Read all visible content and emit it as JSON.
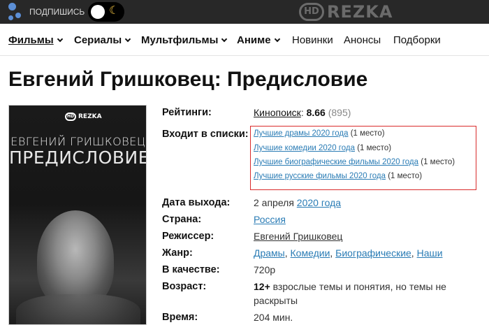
{
  "topbar": {
    "subscribe_label": "ПОДПИШИСЬ",
    "logo_hd": "HD",
    "logo_text": "REZKA"
  },
  "nav": {
    "items": [
      {
        "label": "Фильмы",
        "dropdown": true,
        "active": true
      },
      {
        "label": "Сериалы",
        "dropdown": true
      },
      {
        "label": "Мультфильмы",
        "dropdown": true
      },
      {
        "label": "Аниме",
        "dropdown": true
      },
      {
        "label": "Новинки",
        "dropdown": false
      },
      {
        "label": "Анонсы",
        "dropdown": false
      },
      {
        "label": "Подборки",
        "dropdown": false
      }
    ]
  },
  "page": {
    "title": "Евгений Гришковец: Предисловие"
  },
  "poster": {
    "logo_hd": "HD",
    "logo_text": "REZKA",
    "line1": "ЕВГЕНИЙ ГРИШКОВЕЦ",
    "line2": "ПРЕДИСЛОВИЕ"
  },
  "info": {
    "ratings_label": "Рейтинги:",
    "rating_source": "Кинопоиск",
    "rating_colon": ":",
    "rating_value": "8.66",
    "rating_votes": "(895)",
    "lists_label": "Входит в списки:",
    "lists": [
      {
        "name": "Лучшие драмы 2020 года",
        "place": "(1 место)"
      },
      {
        "name": "Лучшие комедии 2020 года",
        "place": "(1 место)"
      },
      {
        "name": "Лучшие биографические фильмы 2020 года",
        "place": "(1 место)"
      },
      {
        "name": "Лучшие русские фильмы 2020 года",
        "place": "(1 место)"
      }
    ],
    "release_label": "Дата выхода:",
    "release_day": "2 апреля",
    "release_year": "2020 года",
    "country_label": "Страна:",
    "country": "Россия",
    "director_label": "Режиссер:",
    "director": "Евгений Гришковец",
    "genre_label": "Жанр:",
    "genres": [
      "Драмы",
      "Комедии",
      "Биографические",
      "Наши"
    ],
    "quality_label": "В качестве:",
    "quality": "720p",
    "age_label": "Возраст:",
    "age_rating": "12+",
    "age_text_1": "взрослые темы и понятия, но темы не",
    "age_text_2": "раскрыты",
    "time_label": "Время:",
    "time": "204 мин."
  },
  "colors": {
    "topbar_bg": "#282828",
    "link": "#2a7cb5",
    "highlight_box": "#d92b2b"
  }
}
